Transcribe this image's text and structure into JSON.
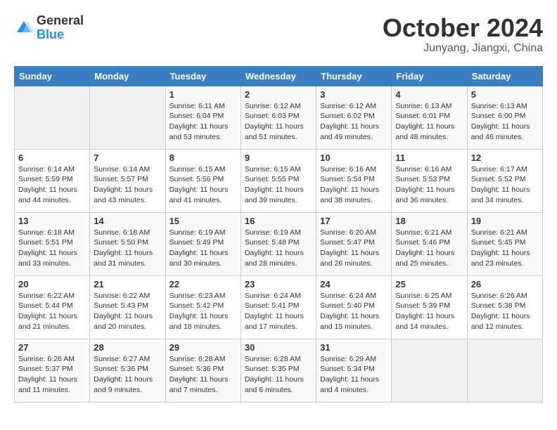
{
  "header": {
    "logo_general": "General",
    "logo_blue": "Blue",
    "month": "October 2024",
    "location": "Junyang, Jiangxi, China"
  },
  "weekdays": [
    "Sunday",
    "Monday",
    "Tuesday",
    "Wednesday",
    "Thursday",
    "Friday",
    "Saturday"
  ],
  "weeks": [
    [
      {
        "day": "",
        "sunrise": "",
        "sunset": "",
        "daylight": ""
      },
      {
        "day": "",
        "sunrise": "",
        "sunset": "",
        "daylight": ""
      },
      {
        "day": "1",
        "sunrise": "Sunrise: 6:11 AM",
        "sunset": "Sunset: 6:04 PM",
        "daylight": "Daylight: 11 hours and 53 minutes."
      },
      {
        "day": "2",
        "sunrise": "Sunrise: 6:12 AM",
        "sunset": "Sunset: 6:03 PM",
        "daylight": "Daylight: 11 hours and 51 minutes."
      },
      {
        "day": "3",
        "sunrise": "Sunrise: 6:12 AM",
        "sunset": "Sunset: 6:02 PM",
        "daylight": "Daylight: 11 hours and 49 minutes."
      },
      {
        "day": "4",
        "sunrise": "Sunrise: 6:13 AM",
        "sunset": "Sunset: 6:01 PM",
        "daylight": "Daylight: 11 hours and 48 minutes."
      },
      {
        "day": "5",
        "sunrise": "Sunrise: 6:13 AM",
        "sunset": "Sunset: 6:00 PM",
        "daylight": "Daylight: 11 hours and 46 minutes."
      }
    ],
    [
      {
        "day": "6",
        "sunrise": "Sunrise: 6:14 AM",
        "sunset": "Sunset: 5:59 PM",
        "daylight": "Daylight: 11 hours and 44 minutes."
      },
      {
        "day": "7",
        "sunrise": "Sunrise: 6:14 AM",
        "sunset": "Sunset: 5:57 PM",
        "daylight": "Daylight: 11 hours and 43 minutes."
      },
      {
        "day": "8",
        "sunrise": "Sunrise: 6:15 AM",
        "sunset": "Sunset: 5:56 PM",
        "daylight": "Daylight: 11 hours and 41 minutes."
      },
      {
        "day": "9",
        "sunrise": "Sunrise: 6:15 AM",
        "sunset": "Sunset: 5:55 PM",
        "daylight": "Daylight: 11 hours and 39 minutes."
      },
      {
        "day": "10",
        "sunrise": "Sunrise: 6:16 AM",
        "sunset": "Sunset: 5:54 PM",
        "daylight": "Daylight: 11 hours and 38 minutes."
      },
      {
        "day": "11",
        "sunrise": "Sunrise: 6:16 AM",
        "sunset": "Sunset: 5:53 PM",
        "daylight": "Daylight: 11 hours and 36 minutes."
      },
      {
        "day": "12",
        "sunrise": "Sunrise: 6:17 AM",
        "sunset": "Sunset: 5:52 PM",
        "daylight": "Daylight: 11 hours and 34 minutes."
      }
    ],
    [
      {
        "day": "13",
        "sunrise": "Sunrise: 6:18 AM",
        "sunset": "Sunset: 5:51 PM",
        "daylight": "Daylight: 11 hours and 33 minutes."
      },
      {
        "day": "14",
        "sunrise": "Sunrise: 6:18 AM",
        "sunset": "Sunset: 5:50 PM",
        "daylight": "Daylight: 11 hours and 31 minutes."
      },
      {
        "day": "15",
        "sunrise": "Sunrise: 6:19 AM",
        "sunset": "Sunset: 5:49 PM",
        "daylight": "Daylight: 11 hours and 30 minutes."
      },
      {
        "day": "16",
        "sunrise": "Sunrise: 6:19 AM",
        "sunset": "Sunset: 5:48 PM",
        "daylight": "Daylight: 11 hours and 28 minutes."
      },
      {
        "day": "17",
        "sunrise": "Sunrise: 6:20 AM",
        "sunset": "Sunset: 5:47 PM",
        "daylight": "Daylight: 11 hours and 26 minutes."
      },
      {
        "day": "18",
        "sunrise": "Sunrise: 6:21 AM",
        "sunset": "Sunset: 5:46 PM",
        "daylight": "Daylight: 11 hours and 25 minutes."
      },
      {
        "day": "19",
        "sunrise": "Sunrise: 6:21 AM",
        "sunset": "Sunset: 5:45 PM",
        "daylight": "Daylight: 11 hours and 23 minutes."
      }
    ],
    [
      {
        "day": "20",
        "sunrise": "Sunrise: 6:22 AM",
        "sunset": "Sunset: 5:44 PM",
        "daylight": "Daylight: 11 hours and 21 minutes."
      },
      {
        "day": "21",
        "sunrise": "Sunrise: 6:22 AM",
        "sunset": "Sunset: 5:43 PM",
        "daylight": "Daylight: 11 hours and 20 minutes."
      },
      {
        "day": "22",
        "sunrise": "Sunrise: 6:23 AM",
        "sunset": "Sunset: 5:42 PM",
        "daylight": "Daylight: 11 hours and 18 minutes."
      },
      {
        "day": "23",
        "sunrise": "Sunrise: 6:24 AM",
        "sunset": "Sunset: 5:41 PM",
        "daylight": "Daylight: 11 hours and 17 minutes."
      },
      {
        "day": "24",
        "sunrise": "Sunrise: 6:24 AM",
        "sunset": "Sunset: 5:40 PM",
        "daylight": "Daylight: 11 hours and 15 minutes."
      },
      {
        "day": "25",
        "sunrise": "Sunrise: 6:25 AM",
        "sunset": "Sunset: 5:39 PM",
        "daylight": "Daylight: 11 hours and 14 minutes."
      },
      {
        "day": "26",
        "sunrise": "Sunrise: 6:26 AM",
        "sunset": "Sunset: 5:38 PM",
        "daylight": "Daylight: 11 hours and 12 minutes."
      }
    ],
    [
      {
        "day": "27",
        "sunrise": "Sunrise: 6:26 AM",
        "sunset": "Sunset: 5:37 PM",
        "daylight": "Daylight: 11 hours and 11 minutes."
      },
      {
        "day": "28",
        "sunrise": "Sunrise: 6:27 AM",
        "sunset": "Sunset: 5:36 PM",
        "daylight": "Daylight: 11 hours and 9 minutes."
      },
      {
        "day": "29",
        "sunrise": "Sunrise: 6:28 AM",
        "sunset": "Sunset: 5:36 PM",
        "daylight": "Daylight: 11 hours and 7 minutes."
      },
      {
        "day": "30",
        "sunrise": "Sunrise: 6:28 AM",
        "sunset": "Sunset: 5:35 PM",
        "daylight": "Daylight: 11 hours and 6 minutes."
      },
      {
        "day": "31",
        "sunrise": "Sunrise: 6:29 AM",
        "sunset": "Sunset: 5:34 PM",
        "daylight": "Daylight: 11 hours and 4 minutes."
      },
      {
        "day": "",
        "sunrise": "",
        "sunset": "",
        "daylight": ""
      },
      {
        "day": "",
        "sunrise": "",
        "sunset": "",
        "daylight": ""
      }
    ]
  ]
}
